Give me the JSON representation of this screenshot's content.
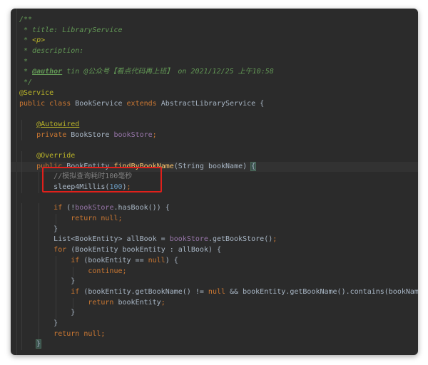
{
  "colors": {
    "background": "#2b2b2b",
    "comment": "#629755",
    "keyword": "#cc7832",
    "annotation": "#bbb529",
    "field": "#9876aa",
    "method": "#ffc66d",
    "number": "#6897bb",
    "line_comment": "#808080",
    "highlight_box": "#e0201b"
  },
  "lines": [
    {
      "indent": "",
      "tokens": [
        {
          "t": "/**",
          "c": "comment"
        }
      ]
    },
    {
      "indent": "",
      "tokens": [
        {
          "t": " * title: LibraryService",
          "c": "comment"
        }
      ]
    },
    {
      "indent": "",
      "tokens": [
        {
          "t": " * ",
          "c": "comment"
        },
        {
          "t": "<p>",
          "c": "doctag"
        }
      ]
    },
    {
      "indent": "",
      "tokens": [
        {
          "t": " * description:",
          "c": "comment"
        }
      ]
    },
    {
      "indent": "",
      "tokens": [
        {
          "t": " *",
          "c": "comment"
        }
      ]
    },
    {
      "indent": "",
      "tokens": [
        {
          "t": " * ",
          "c": "comment"
        },
        {
          "t": "@author",
          "c": "doctag-u"
        },
        {
          "t": " tin @公众号【看点代码再上班】 on 2021/12/25 上午10:58",
          "c": "comment"
        }
      ]
    },
    {
      "indent": "",
      "tokens": [
        {
          "t": " */",
          "c": "comment"
        }
      ]
    },
    {
      "indent": "",
      "tokens": [
        {
          "t": "@Service",
          "c": "annotation"
        }
      ]
    },
    {
      "indent": "",
      "tokens": [
        {
          "t": "public class ",
          "c": "keyword"
        },
        {
          "t": "BookService ",
          "c": "plain"
        },
        {
          "t": "extends ",
          "c": "keyword"
        },
        {
          "t": "AbstractLibraryService {",
          "c": "plain"
        }
      ]
    },
    {
      "indent": "",
      "tokens": []
    },
    {
      "indent": "    ",
      "tokens": [
        {
          "t": "@Autowired",
          "c": "annotation-u"
        }
      ]
    },
    {
      "indent": "    ",
      "tokens": [
        {
          "t": "private ",
          "c": "keyword"
        },
        {
          "t": "BookStore ",
          "c": "plain"
        },
        {
          "t": "bookStore",
          "c": "field"
        },
        {
          "t": ";",
          "c": "keyword"
        }
      ]
    },
    {
      "indent": "",
      "tokens": []
    },
    {
      "indent": "    ",
      "tokens": [
        {
          "t": "@Override",
          "c": "annotation"
        }
      ]
    },
    {
      "indent": "    ",
      "hl": true,
      "tokens": [
        {
          "t": "public ",
          "c": "keyword"
        },
        {
          "t": "BookEntity ",
          "c": "plain"
        },
        {
          "t": "findByBookName",
          "c": "method"
        },
        {
          "t": "(String bookName) ",
          "c": "plain"
        },
        {
          "t": "{",
          "c": "brace"
        }
      ]
    },
    {
      "indent": "        ",
      "tokens": [
        {
          "t": "//模拟查询耗时100毫秒",
          "c": "linecomment"
        }
      ]
    },
    {
      "indent": "        ",
      "tokens": [
        {
          "t": "sleep4Millis(",
          "c": "plain"
        },
        {
          "t": "100",
          "c": "number"
        },
        {
          "t": ")",
          "c": "plain"
        },
        {
          "t": ";",
          "c": "keyword"
        }
      ]
    },
    {
      "indent": "",
      "tokens": []
    },
    {
      "indent": "        ",
      "tokens": [
        {
          "t": "if ",
          "c": "keyword"
        },
        {
          "t": "(!",
          "c": "plain"
        },
        {
          "t": "bookStore",
          "c": "field"
        },
        {
          "t": ".hasBook()) {",
          "c": "plain"
        }
      ]
    },
    {
      "indent": "            ",
      "tokens": [
        {
          "t": "return null;",
          "c": "keyword"
        }
      ]
    },
    {
      "indent": "        ",
      "tokens": [
        {
          "t": "}",
          "c": "plain"
        }
      ]
    },
    {
      "indent": "        ",
      "tokens": [
        {
          "t": "List<BookEntity> allBook = ",
          "c": "plain"
        },
        {
          "t": "bookStore",
          "c": "field"
        },
        {
          "t": ".getBookStore()",
          "c": "plain"
        },
        {
          "t": ";",
          "c": "keyword"
        }
      ]
    },
    {
      "indent": "        ",
      "tokens": [
        {
          "t": "for ",
          "c": "keyword"
        },
        {
          "t": "(BookEntity bookEntity : allBook) {",
          "c": "plain"
        }
      ]
    },
    {
      "indent": "            ",
      "tokens": [
        {
          "t": "if ",
          "c": "keyword"
        },
        {
          "t": "(bookEntity == ",
          "c": "plain"
        },
        {
          "t": "null",
          "c": "keyword"
        },
        {
          "t": ") {",
          "c": "plain"
        }
      ]
    },
    {
      "indent": "                ",
      "tokens": [
        {
          "t": "continue;",
          "c": "keyword"
        }
      ]
    },
    {
      "indent": "            ",
      "tokens": [
        {
          "t": "}",
          "c": "plain"
        }
      ]
    },
    {
      "indent": "            ",
      "tokens": [
        {
          "t": "if ",
          "c": "keyword"
        },
        {
          "t": "(bookEntity.getBookName() != ",
          "c": "plain"
        },
        {
          "t": "null ",
          "c": "keyword"
        },
        {
          "t": "&& bookEntity.getBookName().contains(bookName)) {",
          "c": "plain"
        }
      ]
    },
    {
      "indent": "                ",
      "tokens": [
        {
          "t": "return ",
          "c": "keyword"
        },
        {
          "t": "bookEntity",
          "c": "plain"
        },
        {
          "t": ";",
          "c": "keyword"
        }
      ]
    },
    {
      "indent": "            ",
      "tokens": [
        {
          "t": "}",
          "c": "plain"
        }
      ]
    },
    {
      "indent": "        ",
      "tokens": [
        {
          "t": "}",
          "c": "plain"
        }
      ]
    },
    {
      "indent": "        ",
      "tokens": [
        {
          "t": "return null;",
          "c": "keyword"
        }
      ]
    },
    {
      "indent": "    ",
      "tokens": [
        {
          "t": "}",
          "c": "brace"
        }
      ]
    }
  ]
}
